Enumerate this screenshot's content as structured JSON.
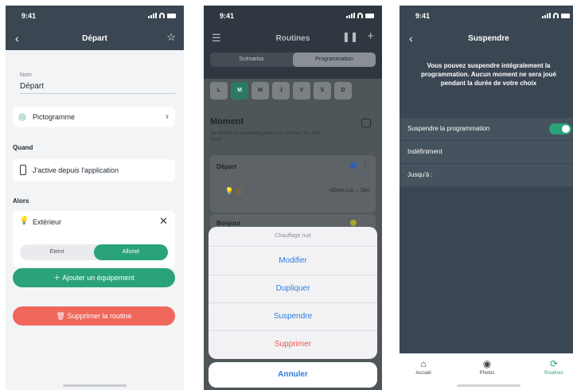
{
  "status_time": "9:41",
  "screen1": {
    "title": "Départ",
    "name_label": "Nom",
    "name_value": "Départ",
    "pictogram_label": "Pictogramme",
    "when_title": "Quand",
    "when_value": "J'active depuis l'application",
    "then_title": "Alors",
    "device_name": "Extérieur",
    "seg_off": "Éteint",
    "seg_on": "Allumé",
    "add_button": "Ajouter un équipement",
    "delete_button": "Supprimer la routine"
  },
  "screen2": {
    "title": "Routines",
    "tab_scenarios": "Scénarios",
    "tab_programming": "Programmation",
    "days": [
      "L",
      "M",
      "M",
      "J",
      "V",
      "S",
      "D"
    ],
    "active_day_index": 1,
    "moment_title": "Moment",
    "moment_desc": "Se déclenche automatiquement au moment de votre choix",
    "card1_title": "Départ",
    "card1_time": "+30min  Lun → Dim",
    "card2_title": "Bonjour",
    "sheet_header": "Chauffage nuit",
    "sheet_items": [
      "Modifier",
      "Dupliquer",
      "Suspendre",
      "Supprimer"
    ],
    "cancel": "Annuler"
  },
  "screen3": {
    "title": "Suspendre",
    "description": "Vous pouvez suspendre intégralement la programmation. Aucun moment ne sera joué pendant la durée de votre choix",
    "row_suspend": "Suspendre la programmation",
    "row_indef": "Indéfiniment",
    "row_until": "Jusqu'à :",
    "tabs": [
      "Accueil",
      "Photos",
      "Routines"
    ]
  },
  "colors": {
    "accent": "#2aa27a",
    "header": "#3a4652",
    "danger": "#f0675c",
    "link": "#2f7ee0"
  }
}
